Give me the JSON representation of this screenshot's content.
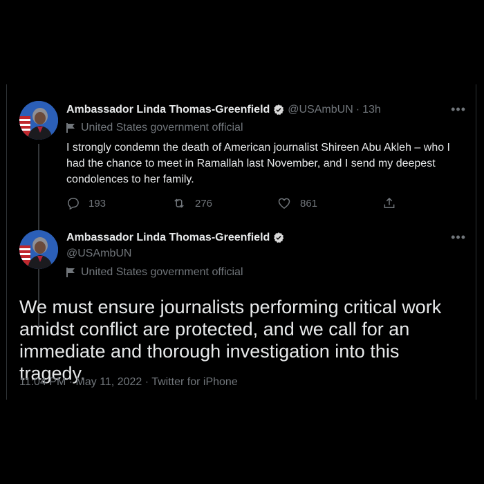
{
  "tweet1": {
    "name": "Ambassador Linda Thomas-Greenfield",
    "handle": "@USAmbUN",
    "time": "13h",
    "label": "United States government official",
    "text": "I strongly condemn the death of American journalist Shireen Abu Akleh – who I had the chance to meet in Ramallah last November, and I send my deepest condolences to her family.",
    "replies": "193",
    "retweets": "276",
    "likes": "861"
  },
  "tweet2": {
    "name": "Ambassador Linda Thomas-Greenfield",
    "handle": "@USAmbUN",
    "label": "United States government official",
    "text": "We must ensure journalists performing critical work amidst conflict are protected, and we call for an immediate and thorough investigation into this tragedy.",
    "timestamp": "11:04 PM · May 11, 2022 · Twitter for iPhone"
  },
  "icons": {
    "verified": "verified-badge-icon",
    "flag": "flag-icon",
    "more": "more-icon",
    "reply": "reply-icon",
    "retweet": "retweet-icon",
    "like": "heart-icon",
    "share": "share-icon"
  },
  "colors": {
    "background": "#000000",
    "text": "#e7e9ea",
    "secondary": "#71767b",
    "verified": "#d9d9d9",
    "divider": "#2f3336"
  }
}
